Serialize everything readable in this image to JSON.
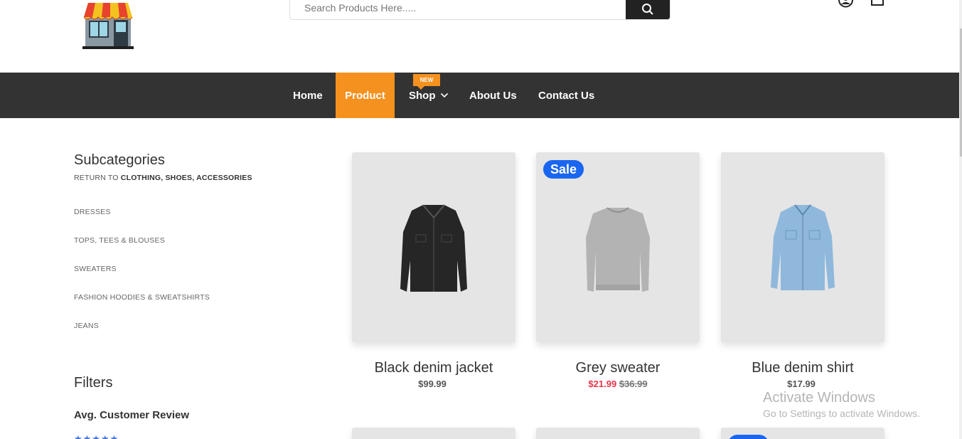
{
  "header": {
    "search_placeholder": "Search Products Here.....",
    "search_value": ""
  },
  "nav": {
    "items": [
      {
        "label": "Home"
      },
      {
        "label": "Product"
      },
      {
        "label": "Shop"
      },
      {
        "label": "About Us"
      },
      {
        "label": "Contact Us"
      }
    ],
    "new_badge": "NEW",
    "accent_color": "#f5911e"
  },
  "sidebar": {
    "subcategories_title": "Subcategories",
    "return_prefix": "RETURN TO ",
    "return_target": "CLOTHING, SHOES, ACCESSORIES",
    "categories": [
      "DRESSES",
      "TOPS, TEES & BLOUSES",
      "SWEATERS",
      "FASHION HOODIES & SWEATSHIRTS",
      "JEANS"
    ],
    "filters_title": "Filters",
    "review_title": "Avg. Customer Review",
    "stars": "★★★★★"
  },
  "products": [
    {
      "name": "Black denim jacket",
      "price": "$99.99",
      "image": "black-jacket-icon"
    },
    {
      "name": "Grey sweater",
      "sale_price": "$21.99",
      "old_price": "$36.99",
      "badge": "Sale",
      "image": "grey-sweater-icon"
    },
    {
      "name": "Blue denim shirt",
      "price": "$17.99",
      "image": "blue-shirt-icon"
    }
  ],
  "sale_color": "#1a66f0",
  "watermark": {
    "line1": "Activate Windows",
    "line2": "Go to Settings to activate Windows."
  }
}
